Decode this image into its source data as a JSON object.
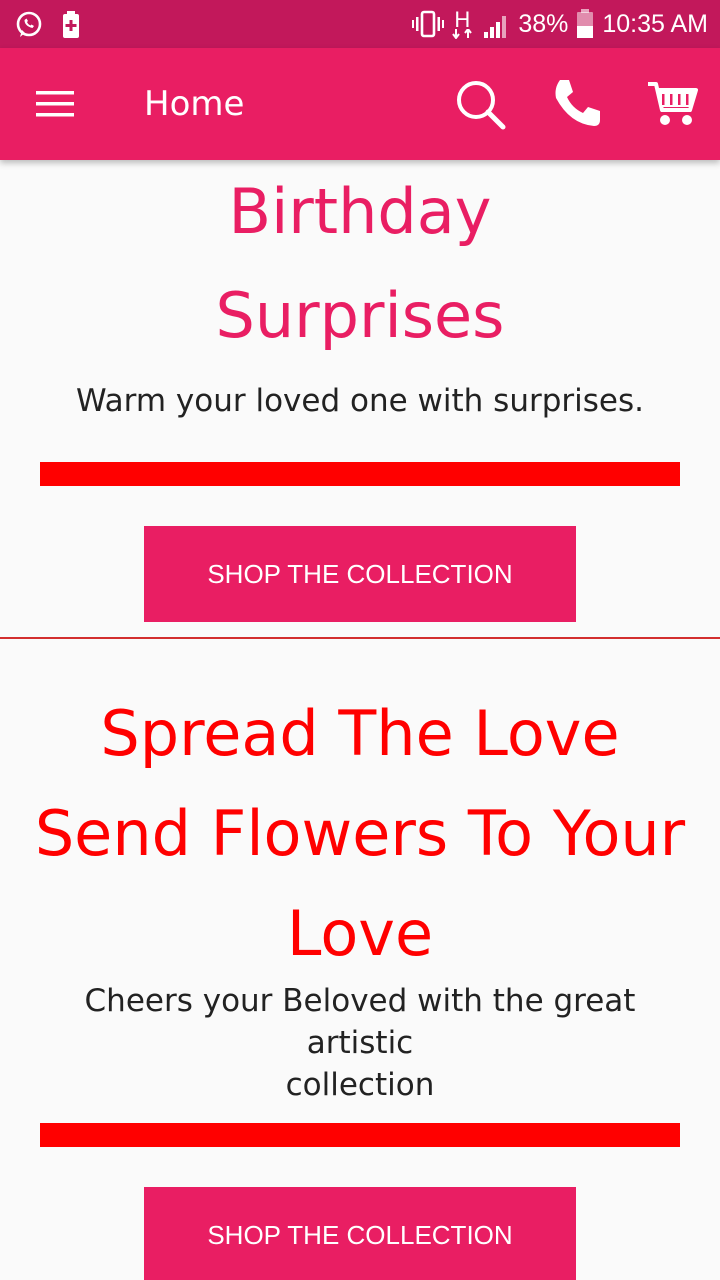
{
  "status_bar": {
    "battery_percent": "38%",
    "time": "10:35 AM",
    "network_type": "H",
    "icons": [
      "whatsapp-icon",
      "battery-saver-icon",
      "vibrate-icon",
      "network-h-icon",
      "signal-icon",
      "battery-icon"
    ]
  },
  "app_bar": {
    "title": "Home",
    "background": "#e91e63",
    "icons": [
      "menu-icon",
      "search-icon",
      "phone-icon",
      "cart-icon"
    ]
  },
  "sections": [
    {
      "heading": "Birthday Surprises",
      "heading_line1": "Birthday",
      "heading_line2": "Surprises",
      "subtitle": "Warm your loved one with surprises.",
      "button_label": "SHOP THE COLLECTION",
      "heading_color": "#e91e63"
    },
    {
      "heading_line1": "Spread The Love",
      "heading_line2": "Send Flowers To Your",
      "heading_line3": "Love",
      "subtitle_line1": "Cheers your Beloved with the great artistic",
      "subtitle_line2": "collection",
      "button_label": "SHOP THE COLLECTION",
      "heading_color": "#ff0000"
    }
  ],
  "colors": {
    "status_bar": "#c2185b",
    "accent": "#e91e63",
    "red_bar": "#ff0000"
  }
}
